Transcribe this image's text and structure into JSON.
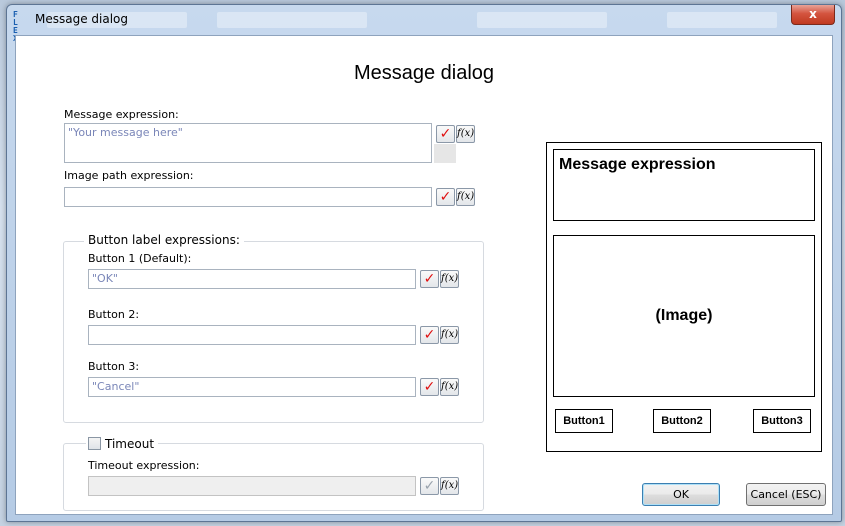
{
  "window": {
    "title": "Message dialog",
    "close_label": "x"
  },
  "dialog": {
    "heading": "Message dialog",
    "message_expression": {
      "label": "Message expression:",
      "value": "\"Your message here\""
    },
    "image_path_expression": {
      "label": "Image path expression:",
      "value": ""
    },
    "button_labels_group": {
      "title": "Button label expressions:",
      "button1": {
        "label": "Button 1 (Default):",
        "value": "\"OK\""
      },
      "button2": {
        "label": "Button 2:",
        "value": ""
      },
      "button3": {
        "label": "Button 3:",
        "value": "\"Cancel\""
      }
    },
    "timeout_group": {
      "checkbox_label": "Timeout",
      "checked": false,
      "expression_label": "Timeout expression:",
      "value": ""
    },
    "check_symbol": "✓",
    "fx_label": "f(x)"
  },
  "preview": {
    "message": "Message expression",
    "image": "(Image)",
    "buttons": [
      "Button1",
      "Button2",
      "Button3"
    ]
  },
  "footer": {
    "ok_label": "OK",
    "cancel_label": "Cancel (ESC)"
  },
  "colors": {
    "check_active": "#e01010",
    "expression_text": "#7a86b8"
  }
}
